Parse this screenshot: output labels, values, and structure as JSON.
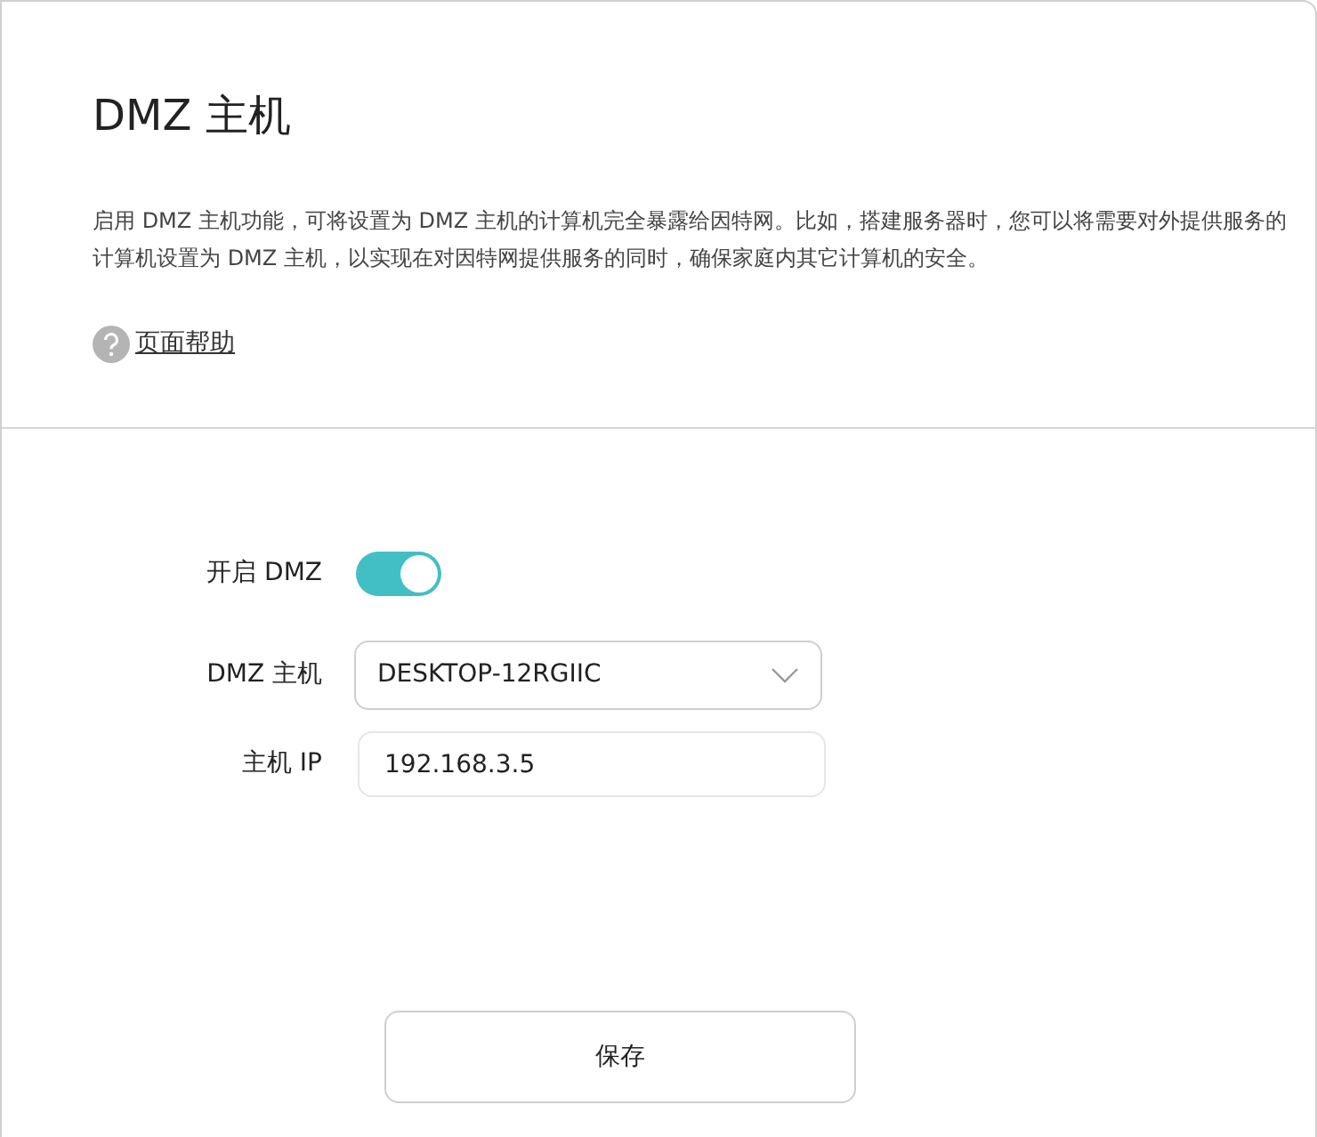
{
  "title": "DMZ 主机",
  "description": "启用 DMZ 主机功能，可将设置为 DMZ 主机的计算机完全暴露给因特网。比如，搭建服务器时，您可以将需要对外提供服务的计算机设置为 DMZ 主机，以实现在对因特网提供服务的同时，确保家庭内其它计算机的安全。",
  "help_link": "页面帮助",
  "fields": [
    {
      "kind": "toggle",
      "label": "开启 DMZ",
      "on": true
    },
    {
      "kind": "select",
      "label": "DMZ 主机",
      "value": "DESKTOP-12RGIIC"
    },
    {
      "kind": "input",
      "label": "主机 IP",
      "value": "192.168.3.5"
    }
  ],
  "save_button": "保存"
}
